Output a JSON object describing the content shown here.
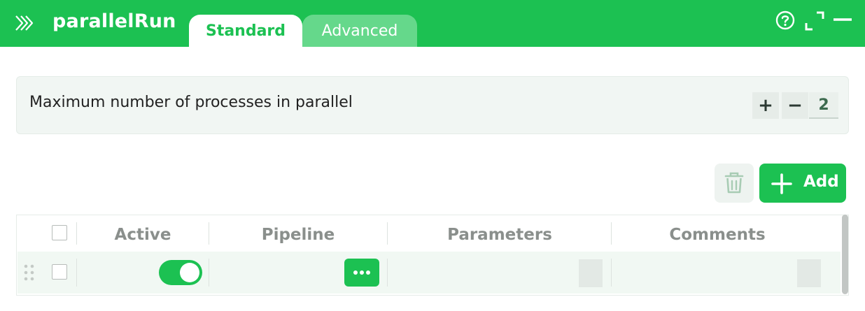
{
  "header": {
    "title": "parallelRun",
    "tabs": [
      {
        "label": "Standard",
        "active": true
      },
      {
        "label": "Advanced",
        "active": false
      }
    ],
    "icons": [
      "chevrons-right-icon",
      "help-icon",
      "expand-icon",
      "minimize-icon"
    ],
    "color": "#1cc152"
  },
  "parameter": {
    "label": "Maximum number of processes in parallel",
    "increment_label": "+",
    "decrement_label": "−",
    "value": "2"
  },
  "toolbar": {
    "delete_icon": "trash-icon",
    "add_label": "Add"
  },
  "table": {
    "columns": [
      "Active",
      "Pipeline",
      "Parameters",
      "Comments"
    ],
    "rows": [
      {
        "selected": false,
        "active": true,
        "pipeline_icon": "more-icon",
        "parameters": "",
        "comments": ""
      }
    ]
  }
}
